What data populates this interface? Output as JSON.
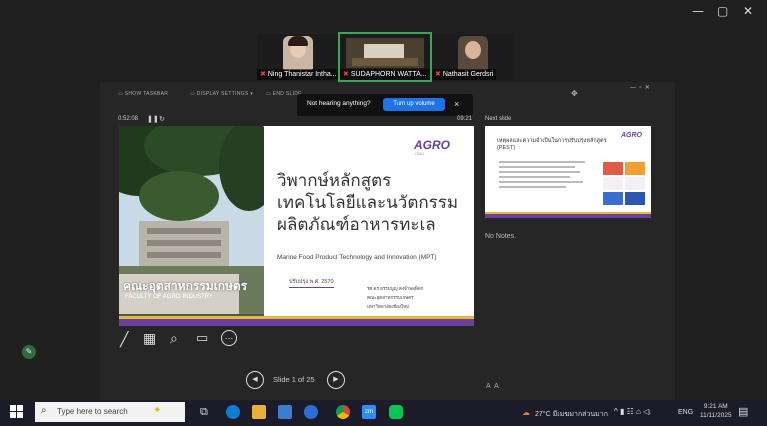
{
  "window": {
    "minimize": "—",
    "maximize": "▢",
    "close": "✕"
  },
  "participants": [
    {
      "name": "Ning Thanistar Intha...",
      "muted": true
    },
    {
      "name": "SUDAPHORN WATTA...",
      "muted": true,
      "active": true
    },
    {
      "name": "Nathasit Gerdsri",
      "muted": true
    }
  ],
  "presenter_toolbar": {
    "taskbar": "SHOW TASKBAR",
    "display": "DISPLAY SETTINGS ▾",
    "end": "END SLIDE..."
  },
  "notification": {
    "message": "Not hearing anything?",
    "button": "Turn up volume",
    "close": "×"
  },
  "timer": {
    "elapsed": "0:52:08",
    "clock": "09:21"
  },
  "slide": {
    "logo": "AGRO",
    "logo_sub": "CMU",
    "title_lines": [
      "วิพากษ์หลักสูตร",
      "เทคโนโลยีและนวัตกรรม",
      "ผลิตภัณฑ์อาหารทะเล"
    ],
    "subtitle": "Marine Food Product Technology and Innovation (MPT)",
    "revision": "ปรับปรุง พ.ศ. 2570",
    "author_lines": [
      "รศ.ดร.ธรรมนูญ คงจำพลุพิตก",
      "คณะอุตสาหกรรมเกษตร",
      "มหาวิทยาลัยเชียงใหม่"
    ],
    "sign_text": "คณะอุตสาหกรรมเกษตร",
    "sign_sub": "FACULTY OF AGRO-INDUSTRY"
  },
  "next_slide": {
    "label": "Next slide",
    "logo": "AGRO",
    "title": "เหตุผลและความจำเป็นในการปรับปรุงหลักสูตร (PEST)"
  },
  "notes": {
    "text": "No Notes."
  },
  "nav": {
    "counter": "Slide 1 of 25",
    "prev": "◀",
    "next": "▶"
  },
  "tools": [
    "pen-icon",
    "grid-icon",
    "zoom-icon",
    "pointer-icon",
    "more-icon"
  ],
  "taskbar": {
    "search_placeholder": "Type here to search",
    "weather": "27°C มีเมฆมากส่วนมาก",
    "lang": "ENG",
    "time": "9:21 AM",
    "date": "11/11/2025"
  }
}
